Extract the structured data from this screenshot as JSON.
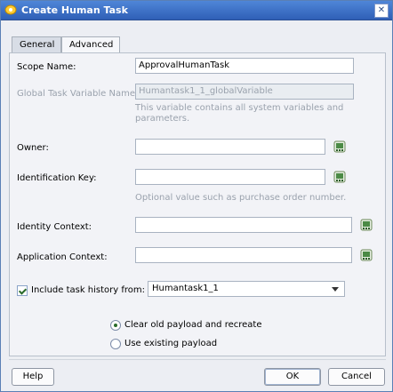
{
  "window": {
    "title": "Create Human Task",
    "close_glyph": "✕"
  },
  "tabs": [
    {
      "label": "General",
      "active": false
    },
    {
      "label": "Advanced",
      "active": true
    }
  ],
  "form": {
    "scope_name": {
      "label": "Scope Name:",
      "value": "ApprovalHumanTask"
    },
    "global_task_var": {
      "label": "Global Task Variable Name:",
      "value": "Humantask1_1_globalVariable",
      "help": [
        "This variable contains all system variables and",
        "parameters."
      ]
    },
    "owner": {
      "label": "Owner:",
      "value": ""
    },
    "identification_key": {
      "label": "Identification Key:",
      "value": "",
      "help": "Optional value such as purchase order number."
    },
    "identity_context": {
      "label": "Identity Context:",
      "value": ""
    },
    "application_context": {
      "label": "Application Context:",
      "value": ""
    },
    "include_history": {
      "label": "Include task history from:",
      "checked": true,
      "selected": "Humantask1_1"
    },
    "payload": {
      "options": [
        {
          "label": "Clear old payload and recreate",
          "checked": true
        },
        {
          "label": "Use existing payload",
          "checked": false
        }
      ]
    }
  },
  "buttons": {
    "help": "Help",
    "ok": "OK",
    "cancel": "Cancel"
  },
  "icons": {
    "app": "app-icon",
    "expression_builder": "expression-builder-icon",
    "close": "close-icon",
    "dropdown": "chevron-down-icon"
  }
}
